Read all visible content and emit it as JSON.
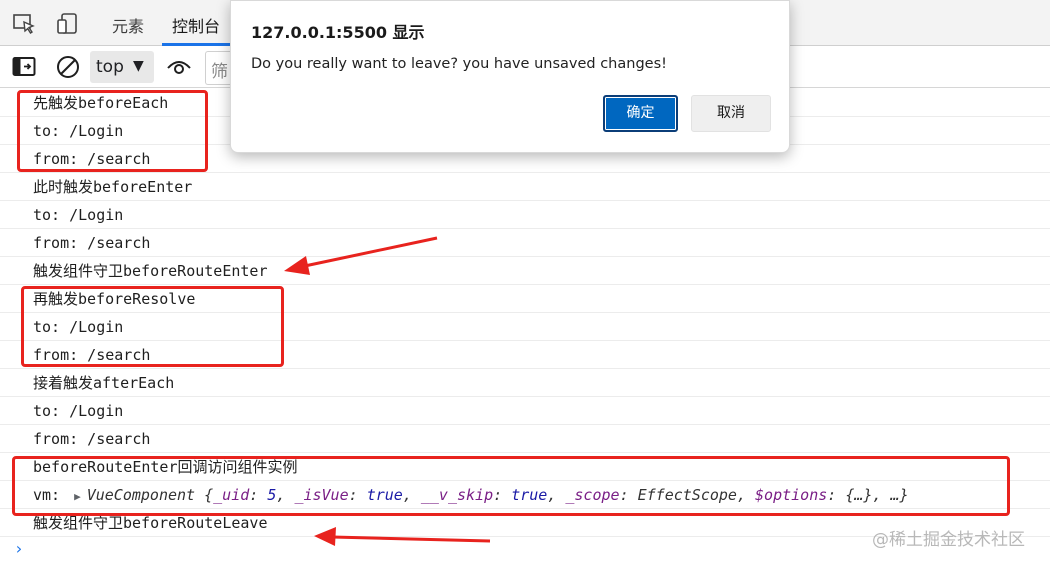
{
  "devtools": {
    "tabs": [
      {
        "label": "元素"
      },
      {
        "label": "控制台",
        "active": true
      }
    ],
    "toolbar": {
      "context": "top",
      "filter_placeholder": "筛"
    }
  },
  "console": {
    "lines": [
      "先触发beforeEach",
      "to: /Login",
      "from: /search",
      "此时触发beforeEnter",
      "to: /Login",
      "from: /search",
      "触发组件守卫beforeRouteEnter",
      "再触发beforeResolve",
      "to: /Login",
      "from: /search",
      "接着触发afterEach",
      "to: /Login",
      "from: /search",
      "beforeRouteEnter回调访问组件实例"
    ],
    "vm_line": {
      "label": "vm:",
      "object_name": "VueComponent",
      "open_brace": "{",
      "props": [
        {
          "key": "_uid",
          "value": "5"
        },
        {
          "key": "_isVue",
          "value": "true"
        },
        {
          "key": "__v_skip",
          "value": "true"
        },
        {
          "key": "_scope",
          "value": "EffectScope"
        },
        {
          "key": "$options",
          "value": "{…}"
        }
      ],
      "ellipsis": "…}"
    },
    "last_line": "触发组件守卫beforeRouteLeave",
    "prompt": "›"
  },
  "dialog": {
    "title": "127.0.0.1:5500 显示",
    "message": "Do you really want to leave? you have unsaved changes!",
    "ok_label": "确定",
    "cancel_label": "取消"
  },
  "watermark": "@稀土掘金技术社区",
  "colors": {
    "annotation_red": "#e8231e",
    "primary_button": "#0067c0",
    "active_tab_underline": "#1a73e8"
  },
  "icons": [
    "inspect-element-icon",
    "device-toolbar-icon",
    "sidebar-toggle-icon",
    "clear-console-icon",
    "eye-icon",
    "dropdown-caret-icon",
    "expand-triangle-icon",
    "prompt-chevron-icon"
  ]
}
